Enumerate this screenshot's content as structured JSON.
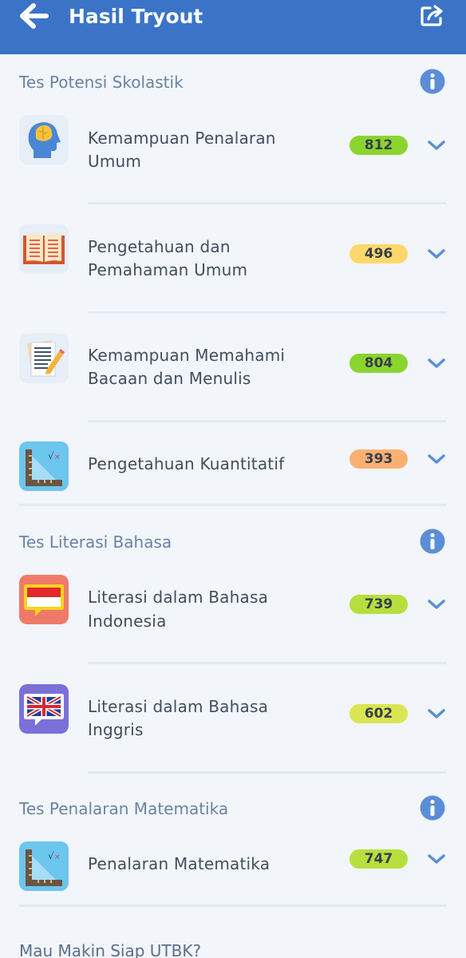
{
  "header": {
    "title": "Hasil Tryout",
    "back_icon": "arrow-left-icon",
    "share_icon": "share-icon",
    "color": "#3b74c7"
  },
  "sections": [
    {
      "title": "Tes Potensi Skolastik",
      "info_icon": "info-icon",
      "items": [
        {
          "label_line1": "Kemampuan Penalaran",
          "label_line2": "Umum",
          "score": "812",
          "score_color": "#8bd42f",
          "icon": "head-brain-icon"
        },
        {
          "label_line1": "Pengetahuan dan",
          "label_line2": "Pemahaman Umum",
          "score": "496",
          "score_color": "#fcd86a",
          "icon": "open-book-icon"
        },
        {
          "label_line1": "Kemampuan Memahami",
          "label_line2": "Bacaan dan Menulis",
          "score": "804",
          "score_color": "#8bd42f",
          "icon": "document-pencil-icon"
        },
        {
          "label_line1": "Pengetahuan Kuantitatif",
          "label_line2": "",
          "score": "393",
          "score_color": "#fbb072",
          "icon": "ruler-math-icon"
        }
      ]
    },
    {
      "title": "Tes Literasi Bahasa",
      "info_icon": "info-icon",
      "items": [
        {
          "label_line1": "Literasi dalam Bahasa",
          "label_line2": "Indonesia",
          "score": "739",
          "score_color": "#b6df3e",
          "icon": "indonesia-flag-chat-icon"
        },
        {
          "label_line1": "Literasi dalam Bahasa",
          "label_line2": "Inggris",
          "score": "602",
          "score_color": "#d9e651",
          "icon": "uk-flag-chat-icon"
        }
      ]
    },
    {
      "title": "Tes Penalaran Matematika",
      "info_icon": "info-icon",
      "items": [
        {
          "label_line1": "Penalaran Matematika",
          "label_line2": "",
          "score": "747",
          "score_color": "#b6df3e",
          "icon": "ruler-math-icon"
        }
      ]
    }
  ],
  "footer": {
    "promo_text": "Mau Makin Siap UTBK?"
  }
}
